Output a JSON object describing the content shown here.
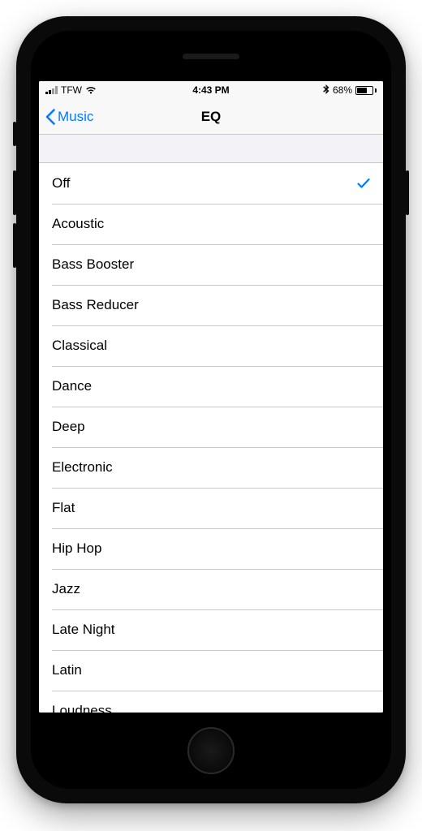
{
  "status": {
    "carrier": "TFW",
    "time": "4:43 PM",
    "battery_pct": "68%"
  },
  "nav": {
    "back_label": "Music",
    "title": "EQ"
  },
  "eq": {
    "selected_index": 0,
    "options": [
      "Off",
      "Acoustic",
      "Bass Booster",
      "Bass Reducer",
      "Classical",
      "Dance",
      "Deep",
      "Electronic",
      "Flat",
      "Hip Hop",
      "Jazz",
      "Late Night",
      "Latin",
      "Loudness"
    ]
  }
}
